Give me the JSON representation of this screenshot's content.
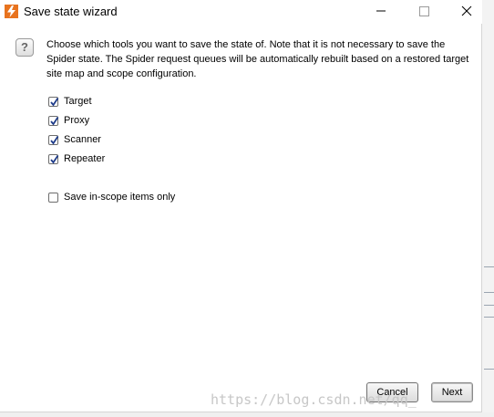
{
  "window": {
    "title": "Save state wizard",
    "minimize_icon": "minimize-icon",
    "maximize_icon": "maximize-icon",
    "close_icon": "close-icon",
    "app_icon": "burp-logo-icon"
  },
  "description": {
    "lines": [
      "Choose which tools you want to save the state of. Note that it is not necessary to save the",
      "Spider state. The Spider request queues will be automatically rebuilt based on a restored target",
      "site map and scope configuration."
    ],
    "help_icon": "?"
  },
  "tools": [
    {
      "label": "Target",
      "checked": true
    },
    {
      "label": "Proxy",
      "checked": true
    },
    {
      "label": "Scanner",
      "checked": true
    },
    {
      "label": "Repeater",
      "checked": true
    }
  ],
  "scope_option": {
    "label": "Save in-scope items only",
    "checked": false
  },
  "buttons": {
    "cancel": "Cancel",
    "next": "Next"
  },
  "watermark": "https://blog.csdn.net/qq_",
  "colors": {
    "accent": "#e8731e",
    "check": "#1f3c8a"
  }
}
